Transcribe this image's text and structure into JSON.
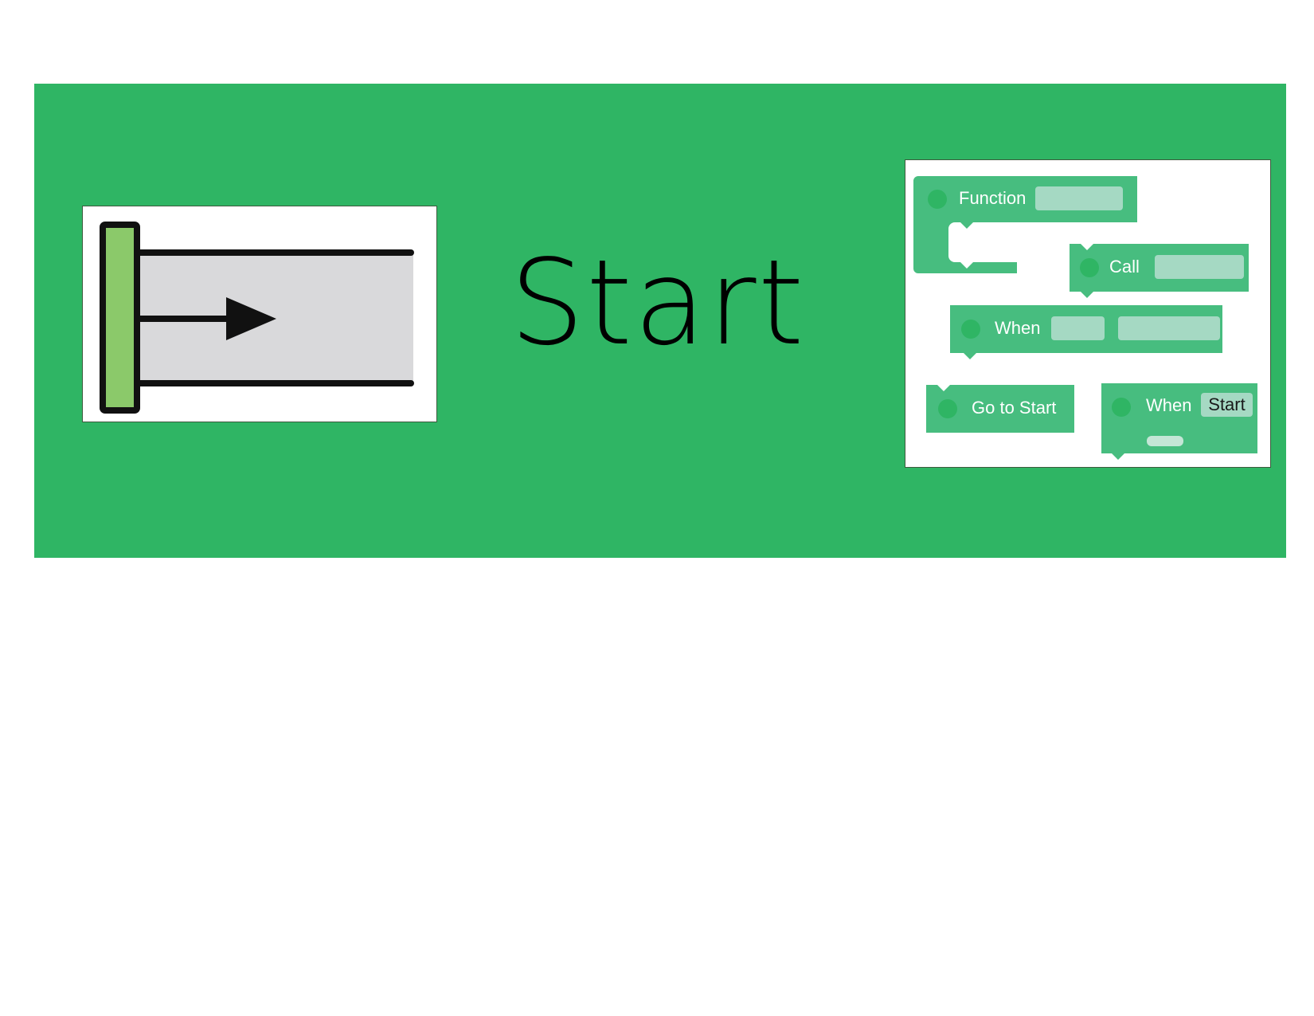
{
  "card": {
    "title": "Start",
    "background_color": "#2fb564",
    "icon": "start-arrow-icon",
    "icon_colors": {
      "bar": "#8bc96a",
      "track": "#d9d9db",
      "line": "#111111"
    }
  },
  "blocks": {
    "block_color": "#47bd7f",
    "chip_color": "#a5d9c3",
    "function_label": "Function",
    "call_label": "Call",
    "when_label": "When",
    "go_to_start_label": "Go to Start",
    "when_start_label": "When",
    "when_start_value": "Start"
  }
}
